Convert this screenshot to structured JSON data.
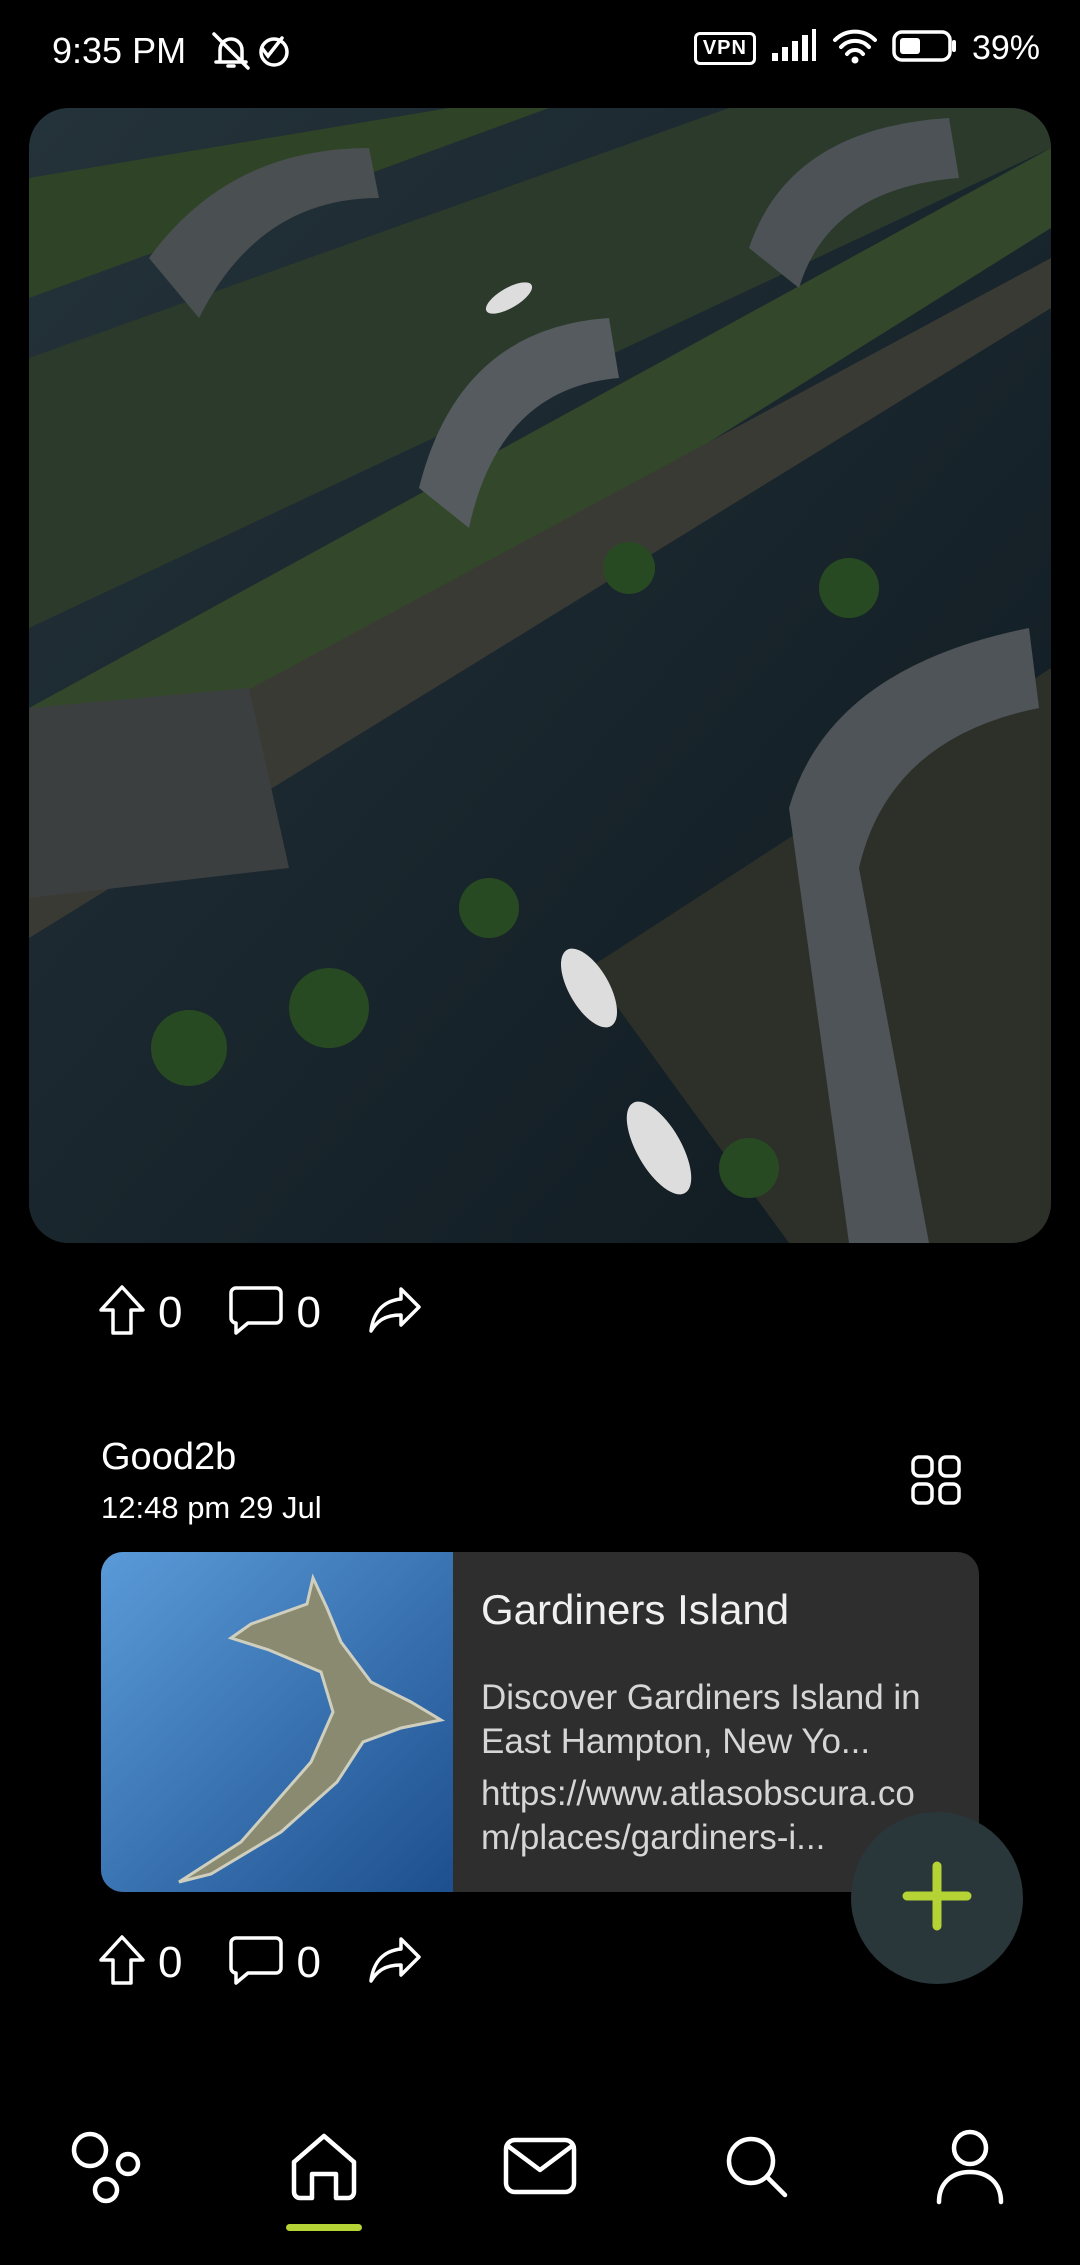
{
  "status_bar": {
    "time": "9:35 PM",
    "vpn": "VPN",
    "battery": "39%"
  },
  "post1": {
    "upvotes": "0",
    "comments": "0"
  },
  "post2": {
    "author": "Good2b",
    "timestamp": "12:48 pm 29 Jul",
    "link_card": {
      "title": "Gardiners Island",
      "description": "Discover Gardiners Island in East Hampton, New Yo...",
      "url": "https://www.atlasobscura.com/places/gardiners-i..."
    },
    "upvotes": "0",
    "comments": "0"
  },
  "colors": {
    "accent": "#b5d334",
    "card_bg": "#2e2e2e",
    "fab_bg": "#29363a"
  },
  "nav": [
    "communities-icon",
    "home-icon",
    "inbox-icon",
    "search-icon",
    "profile-icon"
  ]
}
